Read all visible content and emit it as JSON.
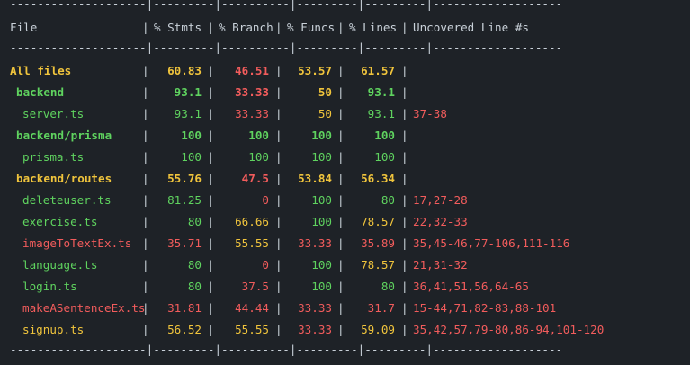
{
  "separator": "--------------------|---------|----------|---------|---------|-------------------",
  "header": {
    "file": "File",
    "stmts": "% Stmts",
    "branch": "% Branch",
    "funcs": "% Funcs",
    "lines": "% Lines",
    "uncovered": "Uncovered Line #s"
  },
  "colors": {
    "green": "#5fd35f",
    "yellow": "#f0c43c",
    "red": "#f25c5c"
  },
  "rows": [
    {
      "file": "All files",
      "indent": 0,
      "file_color": "yellow",
      "bold": true,
      "stmts": "60.83",
      "stmts_color": "yellow",
      "branch": "46.51",
      "branch_color": "red",
      "funcs": "53.57",
      "funcs_color": "yellow",
      "lines": "61.57",
      "lines_color": "yellow",
      "uncovered": "",
      "uncovered_color": "red"
    },
    {
      "file": "backend",
      "indent": 1,
      "file_color": "green",
      "bold": true,
      "stmts": "93.1",
      "stmts_color": "green",
      "branch": "33.33",
      "branch_color": "red",
      "funcs": "50",
      "funcs_color": "yellow",
      "lines": "93.1",
      "lines_color": "green",
      "uncovered": "",
      "uncovered_color": "red"
    },
    {
      "file": "server.ts",
      "indent": 2,
      "file_color": "green",
      "bold": false,
      "stmts": "93.1",
      "stmts_color": "green",
      "branch": "33.33",
      "branch_color": "red",
      "funcs": "50",
      "funcs_color": "yellow",
      "lines": "93.1",
      "lines_color": "green",
      "uncovered": "37-38",
      "uncovered_color": "red"
    },
    {
      "file": "backend/prisma",
      "indent": 1,
      "file_color": "green",
      "bold": true,
      "stmts": "100",
      "stmts_color": "green",
      "branch": "100",
      "branch_color": "green",
      "funcs": "100",
      "funcs_color": "green",
      "lines": "100",
      "lines_color": "green",
      "uncovered": "",
      "uncovered_color": "red"
    },
    {
      "file": "prisma.ts",
      "indent": 2,
      "file_color": "green",
      "bold": false,
      "stmts": "100",
      "stmts_color": "green",
      "branch": "100",
      "branch_color": "green",
      "funcs": "100",
      "funcs_color": "green",
      "lines": "100",
      "lines_color": "green",
      "uncovered": "",
      "uncovered_color": "red"
    },
    {
      "file": "backend/routes",
      "indent": 1,
      "file_color": "yellow",
      "bold": true,
      "stmts": "55.76",
      "stmts_color": "yellow",
      "branch": "47.5",
      "branch_color": "red",
      "funcs": "53.84",
      "funcs_color": "yellow",
      "lines": "56.34",
      "lines_color": "yellow",
      "uncovered": "",
      "uncovered_color": "red"
    },
    {
      "file": "deleteuser.ts",
      "indent": 2,
      "file_color": "green",
      "bold": false,
      "stmts": "81.25",
      "stmts_color": "green",
      "branch": "0",
      "branch_color": "red",
      "funcs": "100",
      "funcs_color": "green",
      "lines": "80",
      "lines_color": "green",
      "uncovered": "17,27-28",
      "uncovered_color": "red"
    },
    {
      "file": "exercise.ts",
      "indent": 2,
      "file_color": "green",
      "bold": false,
      "stmts": "80",
      "stmts_color": "green",
      "branch": "66.66",
      "branch_color": "yellow",
      "funcs": "100",
      "funcs_color": "green",
      "lines": "78.57",
      "lines_color": "yellow",
      "uncovered": "22,32-33",
      "uncovered_color": "red"
    },
    {
      "file": "imageToTextEx.ts",
      "indent": 2,
      "file_color": "red",
      "bold": false,
      "stmts": "35.71",
      "stmts_color": "red",
      "branch": "55.55",
      "branch_color": "yellow",
      "funcs": "33.33",
      "funcs_color": "red",
      "lines": "35.89",
      "lines_color": "red",
      "uncovered": "35,45-46,77-106,111-116",
      "uncovered_color": "red"
    },
    {
      "file": "language.ts",
      "indent": 2,
      "file_color": "green",
      "bold": false,
      "stmts": "80",
      "stmts_color": "green",
      "branch": "0",
      "branch_color": "red",
      "funcs": "100",
      "funcs_color": "green",
      "lines": "78.57",
      "lines_color": "yellow",
      "uncovered": "21,31-32",
      "uncovered_color": "red"
    },
    {
      "file": "login.ts",
      "indent": 2,
      "file_color": "green",
      "bold": false,
      "stmts": "80",
      "stmts_color": "green",
      "branch": "37.5",
      "branch_color": "red",
      "funcs": "100",
      "funcs_color": "green",
      "lines": "80",
      "lines_color": "green",
      "uncovered": "36,41,51,56,64-65",
      "uncovered_color": "red"
    },
    {
      "file": "makeASentenceEx.ts",
      "indent": 2,
      "file_color": "red",
      "bold": false,
      "stmts": "31.81",
      "stmts_color": "red",
      "branch": "44.44",
      "branch_color": "red",
      "funcs": "33.33",
      "funcs_color": "red",
      "lines": "31.7",
      "lines_color": "red",
      "uncovered": "15-44,71,82-83,88-101",
      "uncovered_color": "red"
    },
    {
      "file": "signup.ts",
      "indent": 2,
      "file_color": "yellow",
      "bold": false,
      "stmts": "56.52",
      "stmts_color": "yellow",
      "branch": "55.55",
      "branch_color": "yellow",
      "funcs": "33.33",
      "funcs_color": "red",
      "lines": "59.09",
      "lines_color": "yellow",
      "uncovered": "35,42,57,79-80,86-94,101-120",
      "uncovered_color": "red"
    }
  ]
}
